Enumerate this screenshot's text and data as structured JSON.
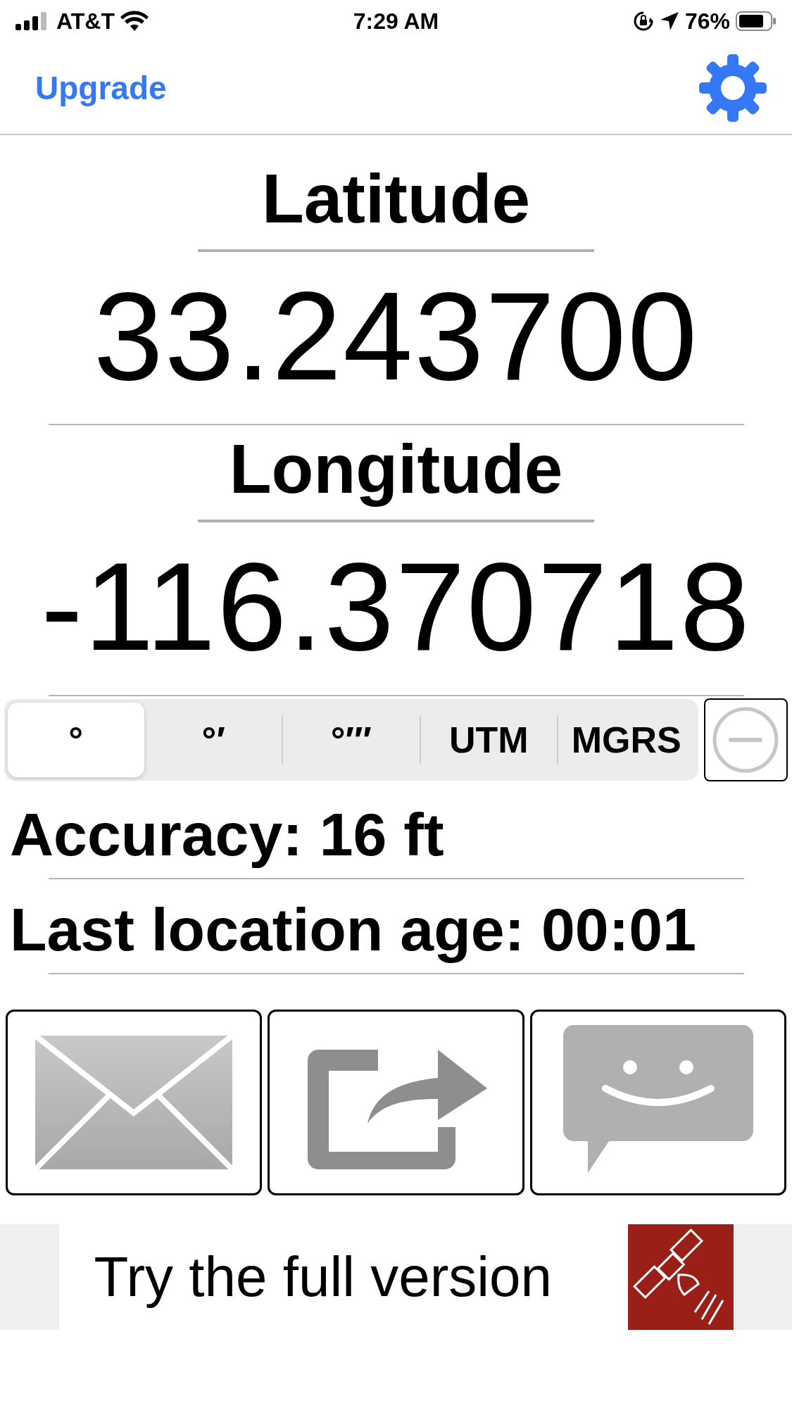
{
  "status_bar": {
    "carrier": "AT&T",
    "time": "7:29 AM",
    "battery": "76%"
  },
  "nav": {
    "left_button": "Upgrade"
  },
  "latitude": {
    "label": "Latitude",
    "value": "33.243700"
  },
  "longitude": {
    "label": "Longitude",
    "value": "-116.370718"
  },
  "format_segments": [
    {
      "label": "°",
      "selected": true
    },
    {
      "label": "°′",
      "selected": false
    },
    {
      "label": "°′″",
      "selected": false
    },
    {
      "label": "UTM",
      "selected": false
    },
    {
      "label": "MGRS",
      "selected": false
    }
  ],
  "accuracy": "Accuracy: 16 ft",
  "location_age": "Last location age: 00:01",
  "actions": [
    {
      "kind": "email"
    },
    {
      "kind": "share"
    },
    {
      "kind": "message"
    }
  ],
  "banner": {
    "text": "Try the full version"
  }
}
